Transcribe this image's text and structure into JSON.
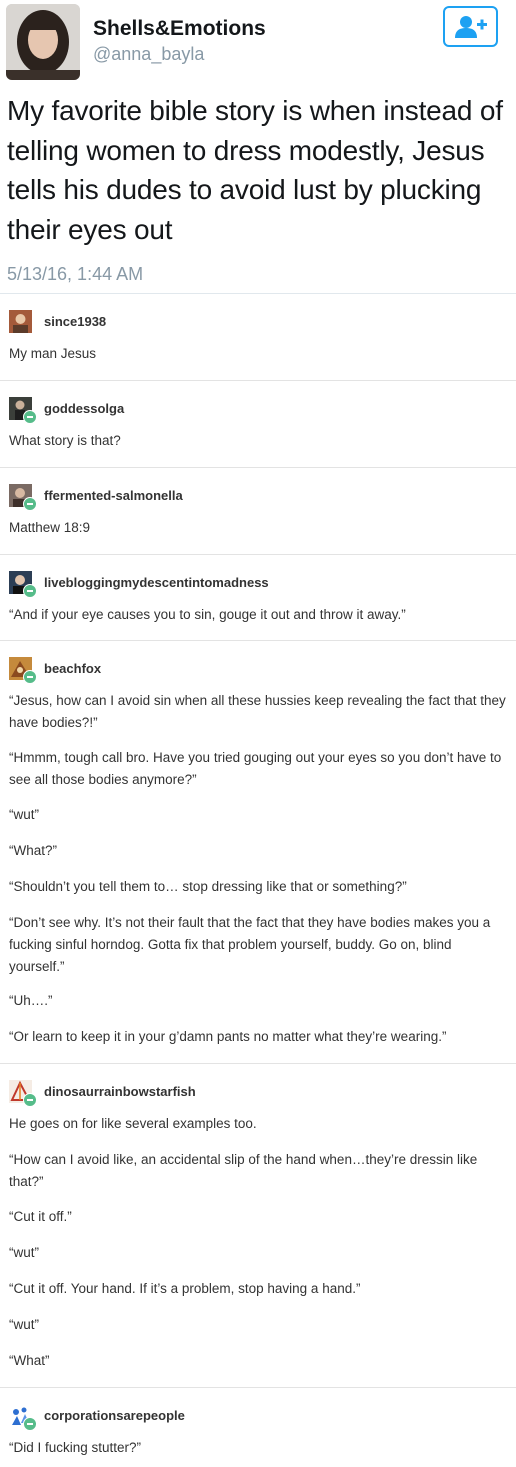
{
  "tweet": {
    "display_name": "Shells&Emotions",
    "handle": "@anna_bayla",
    "text": "My favorite bible story is when instead of telling women to dress modestly, Jesus tells his dudes to avoid lust by plucking their eyes out",
    "timestamp": "5/13/16, 1:44 AM",
    "follow_icon": "add-user-icon",
    "accent_color": "#1da1f2"
  },
  "replies": [
    {
      "username": "since1938",
      "lines": [
        "My man Jesus"
      ]
    },
    {
      "username": "goddessolga",
      "lines": [
        "What story is that?"
      ]
    },
    {
      "username": "ffermented-salmonella",
      "lines": [
        "Matthew 18:9"
      ]
    },
    {
      "username": "livebloggingmydescentintomadness",
      "lines": [
        "“And if your eye causes you to sin, gouge it out and throw it away.”"
      ]
    },
    {
      "username": "beachfox",
      "lines": [
        "“Jesus, how can I avoid sin when all these hussies keep revealing the fact that they have bodies?!”",
        "“Hmmm, tough call bro. Have you tried gouging out your eyes so you don’t have to see all those bodies anymore?”",
        "“wut”",
        "“What?”",
        "“Shouldn’t you tell them to… stop dressing like that or something?”",
        "“Don’t see why. It’s not their fault that the fact that they have bodies makes you a fucking sinful horndog. Gotta fix that problem yourself, buddy. Go on, blind yourself.”",
        "“Uh….”",
        "“Or learn to keep it in your g’damn pants no matter what they’re wearing.”"
      ]
    },
    {
      "username": "dinosaurrainbowstarfish",
      "lines": [
        "He goes on for like several examples too.",
        "“How can I avoid like, an accidental slip of the hand when…they’re dressin like that?”",
        "“Cut it off.”",
        "“wut”",
        "“Cut it off. Your hand. If it’s a problem, stop having a hand.”",
        "“wut”",
        "“What”"
      ]
    },
    {
      "username": "corporationsarepeople",
      "lines": [
        "“Did I fucking stutter?”"
      ]
    }
  ]
}
